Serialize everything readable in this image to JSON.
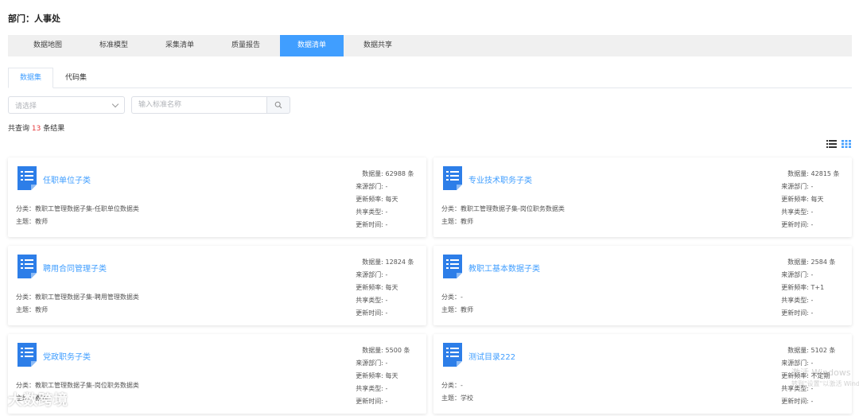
{
  "department": "部门：人事处",
  "tabs": [
    "数据地图",
    "标准模型",
    "采集清单",
    "质量报告",
    "数据清单",
    "数据共享"
  ],
  "subtabs": [
    "数据集",
    "代码集"
  ],
  "filter": {
    "select_placeholder": "请选择",
    "search_placeholder": "输入标准名称"
  },
  "result": {
    "prefix": "共查询",
    "count": "13",
    "suffix": "条结果"
  },
  "stat_labels": {
    "count": "数据量:",
    "source": "来源部门:",
    "freq": "更新频率:",
    "share": "共享类型:",
    "time": "更新时间:"
  },
  "cards": [
    {
      "title": "任职单位子类",
      "category": "分类：教职工管理数据子集-任职单位数据类",
      "topic": "主题：教师",
      "count": "62988 条",
      "source": "-",
      "freq": "每天",
      "share": "-",
      "time": "-"
    },
    {
      "title": "专业技术职务子类",
      "category": "分类：教职工管理数据子集-岗位职务数据类",
      "topic": "主题：教师",
      "count": "42815 条",
      "source": "-",
      "freq": "每天",
      "share": "-",
      "time": "-"
    },
    {
      "title": "聘用合同管理子类",
      "category": "分类：教职工管理数据子集-聘用管理数据类",
      "topic": "主题：教师",
      "count": "12824 条",
      "source": "-",
      "freq": "每天",
      "share": "-",
      "time": "-"
    },
    {
      "title": "教职工基本数据子类",
      "category": "分类：-",
      "topic": "主题：教师",
      "count": "2584 条",
      "source": "-",
      "freq": "T+1",
      "share": "-",
      "time": "-"
    },
    {
      "title": "党政职务子类",
      "category": "分类：教职工管理数据子集-岗位职务数据类",
      "topic": "主题：教师",
      "count": "5500 条",
      "source": "-",
      "freq": "每天",
      "share": "-",
      "time": "-"
    },
    {
      "title": "测试目录222",
      "category": "分类：-",
      "topic": "主题：学校",
      "count": "5102 条",
      "source": "-",
      "freq": "不定期",
      "share": "-",
      "time": "-"
    }
  ],
  "watermark": "大数跨境",
  "windows_watermark": {
    "line1": "激活 Windows",
    "line2": "转到\"设置\"以激活 Windows。"
  },
  "colors": {
    "accent": "#409eff",
    "count_red": "#e4393c"
  }
}
